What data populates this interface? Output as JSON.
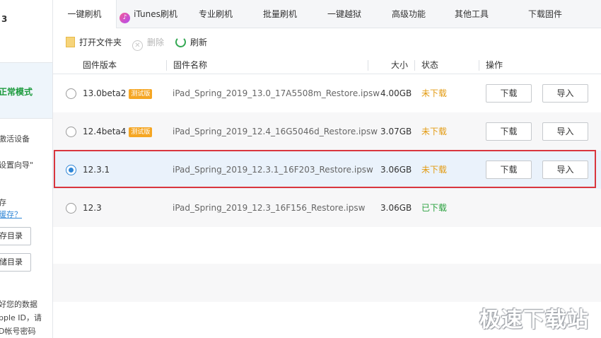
{
  "sidebar": {
    "top_label": "3",
    "status": "正常模式",
    "line1": "激活设备",
    "line2": "设置向导\"",
    "line3": "存",
    "line4_link": "缓存？",
    "btn1": "存目录",
    "btn2": "储目录",
    "note1": "好您的数据",
    "note2": "pple ID，请",
    "note3": "D帐号密码"
  },
  "tabs": [
    {
      "label": "一键刷机",
      "icon": ""
    },
    {
      "label": "iTunes刷机",
      "icon": "itunes-icon"
    },
    {
      "label": "专业刷机",
      "icon": ""
    },
    {
      "label": "批量刷机",
      "icon": ""
    },
    {
      "label": "一键越狱",
      "icon": ""
    },
    {
      "label": "高级功能",
      "icon": ""
    },
    {
      "label": "其他工具",
      "icon": ""
    },
    {
      "label": "下载固件",
      "icon": ""
    }
  ],
  "toolbar": {
    "open_folder": "打开文件夹",
    "delete": "删除",
    "refresh": "刷新"
  },
  "table": {
    "columns": [
      "固件版本",
      "固件名称",
      "大小",
      "状态",
      "操作"
    ],
    "rows": [
      {
        "version": "13.0beta2",
        "badge": "测试版",
        "filename": "iPad_Spring_2019_13.0_17A5508m_Restore.ipsw",
        "size": "4.00GB",
        "status": "未下载",
        "btn_download": "下载",
        "btn_import": "导入",
        "selected": false
      },
      {
        "version": "12.4beta4",
        "badge": "测试版",
        "filename": "iPad_Spring_2019_12.4_16G5046d_Restore.ipsw",
        "size": "3.07GB",
        "status": "未下载",
        "btn_download": "下载",
        "btn_import": "导入",
        "selected": false
      },
      {
        "version": "12.3.1",
        "badge": "",
        "filename": "iPad_Spring_2019_12.3.1_16F203_Restore.ipsw",
        "size": "3.06GB",
        "status": "未下载",
        "btn_download": "下载",
        "btn_import": "导入",
        "selected": true
      },
      {
        "version": "12.3",
        "badge": "",
        "filename": "iPad_Spring_2019_12.3_16F156_Restore.ipsw",
        "size": "3.06GB",
        "status": "已下载",
        "btn_download": "",
        "btn_import": "",
        "selected": false
      }
    ]
  },
  "colors": {
    "accent": "#2f86d6",
    "status_not_downloaded": "#e39b12",
    "status_downloaded": "#2aa13e",
    "highlight": "#d9363e"
  },
  "watermark": "极速下载站"
}
